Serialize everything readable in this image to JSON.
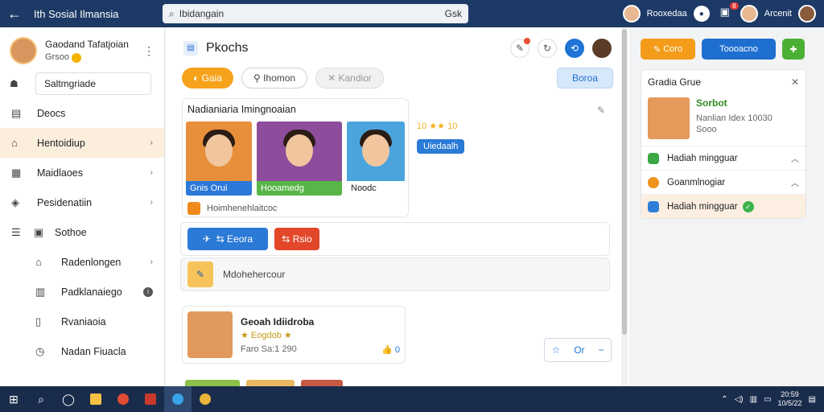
{
  "topbar": {
    "title": "Ith Sosial Ilmansia",
    "search_text": "Ibidangain",
    "search_hint": "Gsk",
    "user1_name": "Rooxedaa",
    "notif_count": "8",
    "user2_name": "Arcenit"
  },
  "sidebar": {
    "profile_name": "Gaodand Tafatjoian",
    "profile_sub": "Grsoo",
    "search_value": "Saltmgriade",
    "items": [
      {
        "label": "Deocs"
      },
      {
        "label": "Hentoidiup"
      },
      {
        "label": "Maidlaoes"
      },
      {
        "label": "Pesidenatiin"
      },
      {
        "label": "Sothoe"
      },
      {
        "label": "Radenlongen"
      },
      {
        "label": "Padklanaiego"
      },
      {
        "label": "Rvaniaoia"
      },
      {
        "label": "Nadan Fiuacla"
      }
    ]
  },
  "main": {
    "title": "Pkochs",
    "tabs": [
      {
        "label": "Gaia"
      },
      {
        "label": "Ihomon"
      },
      {
        "label": "Kandior"
      }
    ],
    "right_tab": "Boroa",
    "card1": {
      "heading": "Nadianiaria Imingnoaian",
      "captions": [
        "Gnis  Orui",
        "Hooamedg",
        "Noodc"
      ],
      "rating": "10 ★★ 10",
      "tag": "Uiedaalh",
      "footer": "Hoimhenehlaitcoc"
    },
    "share": {
      "twitter_label": "Eeora",
      "red_label": "Rsio"
    },
    "note_label": "Mdohehercour",
    "card2": {
      "title": "Geoah Idiidroba",
      "subtitle": "Eogdob",
      "meta": "Faro  Sa:1 290",
      "likes": "0"
    },
    "action_label": "Or"
  },
  "right_panel": {
    "btn_orange": "Coro",
    "btn_blue": "Toooacno",
    "card_title": "Gradia Grue",
    "profile_name": "Sorbot",
    "profile_desc1": "Nanlian Idex 10030",
    "profile_desc2": "Sooo",
    "rows": [
      {
        "label": "Hadiah mingguar",
        "color": "#3aa845"
      },
      {
        "label": "Goanmlnogiar",
        "color": "#f0931c"
      },
      {
        "label": "Hadiah mingguar",
        "color": "#2f7fd9"
      }
    ]
  },
  "taskbar": {
    "time": "20:59",
    "date": "10/5/22"
  }
}
